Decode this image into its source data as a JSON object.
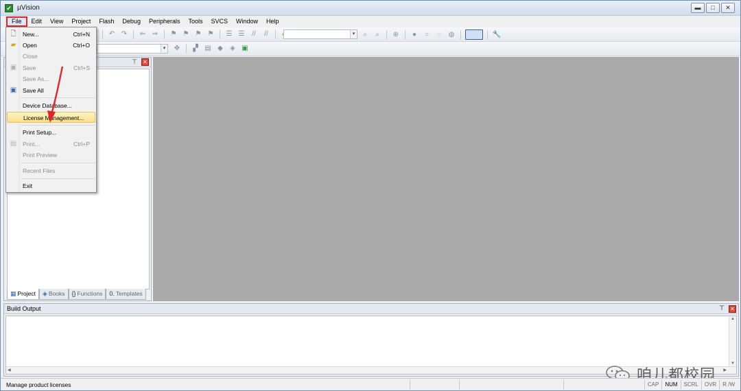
{
  "window": {
    "title": "µVision"
  },
  "menubar": [
    "File",
    "Edit",
    "View",
    "Project",
    "Flash",
    "Debug",
    "Peripherals",
    "Tools",
    "SVCS",
    "Window",
    "Help"
  ],
  "file_menu": {
    "items": [
      {
        "label": "New...",
        "shortcut": "Ctrl+N",
        "icon": "new-file-icon",
        "disabled": false
      },
      {
        "label": "Open",
        "shortcut": "Ctrl+O",
        "icon": "open-folder-icon",
        "disabled": false
      },
      {
        "label": "Close",
        "shortcut": "",
        "icon": "",
        "disabled": true
      },
      {
        "label": "Save",
        "shortcut": "Ctrl+S",
        "icon": "save-icon",
        "disabled": true
      },
      {
        "label": "Save As...",
        "shortcut": "",
        "icon": "",
        "disabled": true
      },
      {
        "label": "Save All",
        "shortcut": "",
        "icon": "save-all-icon",
        "disabled": false
      },
      {
        "label": "Device Database...",
        "shortcut": "",
        "icon": "",
        "disabled": false
      },
      {
        "label": "License Management...",
        "shortcut": "",
        "icon": "",
        "disabled": false,
        "highlighted": true
      },
      {
        "label": "Print Setup...",
        "shortcut": "",
        "icon": "",
        "disabled": false
      },
      {
        "label": "Print...",
        "shortcut": "Ctrl+P",
        "icon": "print-icon",
        "disabled": true
      },
      {
        "label": "Print Preview",
        "shortcut": "",
        "icon": "",
        "disabled": true
      },
      {
        "label": "Recent Files",
        "shortcut": "",
        "icon": "",
        "disabled": true
      },
      {
        "label": "Exit",
        "shortcut": "",
        "icon": "",
        "disabled": false
      }
    ]
  },
  "project_panel": {
    "tabs": [
      {
        "label": "Project",
        "icon": "project-icon",
        "active": true
      },
      {
        "label": "Books",
        "icon": "books-icon",
        "active": false
      },
      {
        "label": "Functions",
        "icon": "functions-icon",
        "active": false
      },
      {
        "label": "Templates",
        "icon": "templates-icon",
        "active": false
      }
    ]
  },
  "build_output": {
    "title": "Build Output"
  },
  "watermark": {
    "text": "咱儿都校园"
  },
  "statusbar": {
    "message": "Manage product licenses",
    "indicators": [
      {
        "label": "CAP",
        "on": false
      },
      {
        "label": "NUM",
        "on": true
      },
      {
        "label": "SCRL",
        "on": false
      },
      {
        "label": "OVR",
        "on": false
      },
      {
        "label": "R /W",
        "on": false
      }
    ]
  },
  "colors": {
    "highlight": "#fbe08a",
    "annotation": "#e0262c",
    "editor_bg": "#aaaaaa"
  }
}
